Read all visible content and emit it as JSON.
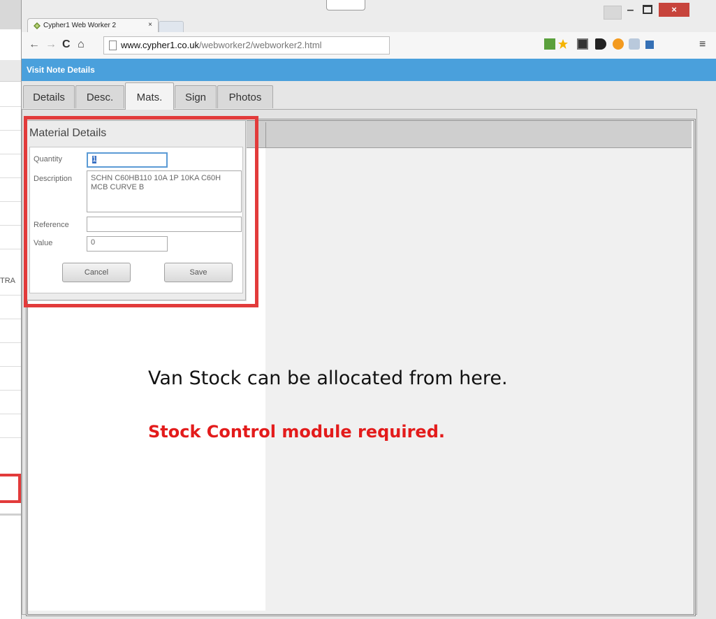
{
  "background_window": {
    "partial_text": "TRA"
  },
  "browser": {
    "tab_title": "Cypher1 Web Worker 2",
    "tab_close": "×",
    "window_min": "‒",
    "window_close": "×",
    "url_domain": "www.cypher1.co.uk",
    "url_path": "/webworker2/webworker2.html",
    "nav_back": "←",
    "nav_forward": "→",
    "nav_reload": "C",
    "nav_home": "⌂",
    "menu": "≡"
  },
  "app": {
    "title": "Visit Note Details",
    "tabs": [
      {
        "label": "Details"
      },
      {
        "label": "Desc."
      },
      {
        "label": "Mats.",
        "active": true
      },
      {
        "label": "Sign"
      },
      {
        "label": "Photos"
      }
    ]
  },
  "dialog": {
    "title": "Material Details",
    "quantity_label": "Quantity",
    "quantity_value": "1",
    "description_label": "Description",
    "description_value": "SCHN C60HB110 10A 1P 10KA C60H MCB CURVE B",
    "reference_label": "Reference",
    "reference_value": "",
    "value_label": "Value",
    "value_value": "0",
    "cancel_label": "Cancel",
    "save_label": "Save"
  },
  "annotation": {
    "line1": "Van Stock can be allocated from here.",
    "line2": "Stock Control module required."
  },
  "colors": {
    "app_bar": "#4aa0dc",
    "highlight_red": "#e23b3b",
    "annotation_red": "#e31b1b",
    "close_button": "#c7443c"
  }
}
